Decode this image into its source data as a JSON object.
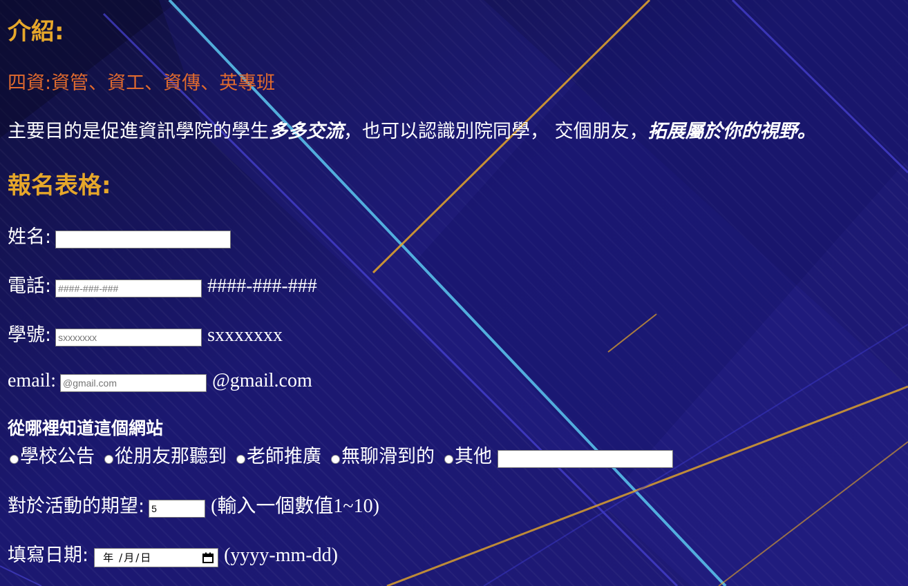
{
  "intro": {
    "heading": "介紹:",
    "departments": "四資:資管、資工、資傳、英專班",
    "purpose_part1": "主要目的是促進資訊學院的學生",
    "purpose_emph1": "多多交流",
    "purpose_part2": "，也可以認識別院同學， 交個朋友，",
    "purpose_emph2": "拓展屬於你的視野。"
  },
  "form": {
    "heading": "報名表格:",
    "name": {
      "label": "姓名:",
      "value": ""
    },
    "phone": {
      "label": "電話:",
      "placeholder": "####-###-###",
      "hint": "####-###-###"
    },
    "student_id": {
      "label": "學號:",
      "placeholder": "sxxxxxxx",
      "hint": "sxxxxxxx"
    },
    "email": {
      "label": "email:",
      "placeholder": "@gmail.com",
      "hint": "@gmail.com"
    },
    "source": {
      "question": "從哪裡知道這個網站",
      "options": [
        "學校公告",
        "從朋友那聽到",
        "老師推廣",
        "無聊滑到的",
        "其他"
      ],
      "other_value": ""
    },
    "expectation": {
      "label": "對於活動的期望:",
      "value": "5",
      "hint": "(輸入一個數值1~10)"
    },
    "date": {
      "label": "填寫日期:",
      "year": "年",
      "month": "月",
      "day": "日",
      "sep": "/",
      "hint": "(yyyy-mm-dd)",
      "icon": "calendar-icon"
    }
  },
  "colors": {
    "heading": "#e6a72a",
    "departments": "#e06a2e",
    "background": "#1a1666",
    "text": "#ffffff"
  }
}
